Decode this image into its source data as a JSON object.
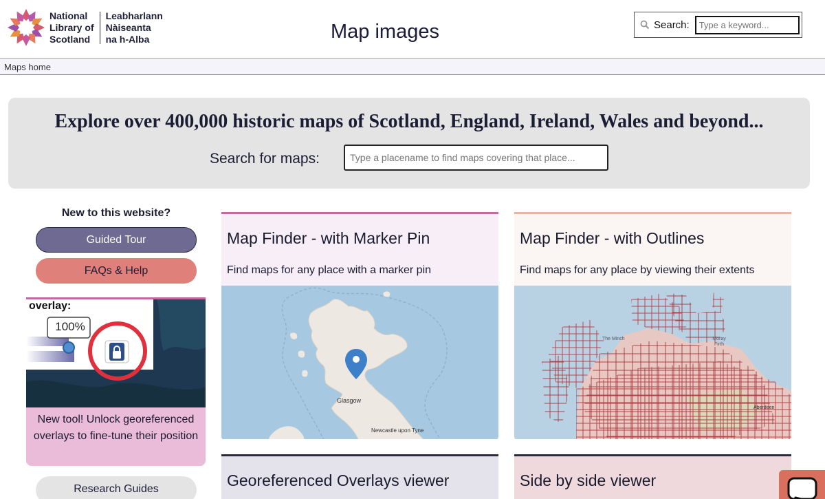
{
  "header": {
    "logo_line1": "National",
    "logo_line2": "Library of",
    "logo_line3": "Scotland",
    "logo_gaelic1": "Leabharlann",
    "logo_gaelic2": "Nàiseanta",
    "logo_gaelic3": "na h-Alba",
    "title": "Map images",
    "search_label": "Search:",
    "search_placeholder": "Type a keyword..."
  },
  "breadcrumb": {
    "home": "Maps home"
  },
  "hero": {
    "heading": "Explore over 400,000 historic maps of Scotland, England, Ireland, Wales and beyond...",
    "search_label": "Search for maps:",
    "search_placeholder": "Type a placename to find maps covering that place..."
  },
  "sidebar": {
    "new_question": "New to this website?",
    "tour_button": "Guided Tour",
    "faq_button": "FAQs & Help",
    "promo_overlay_label": "overlay:",
    "promo_percent": "100%",
    "promo_text": "New tool! Unlock georeferenced overlays to fine-tune their position",
    "research_button": "Research Guides"
  },
  "cards": [
    {
      "title": "Map Finder - with Marker Pin",
      "desc": "Find maps for any place with a marker pin",
      "map_labels": [
        "Glasgow",
        "Newcastle upon Tyne"
      ]
    },
    {
      "title": "Map Finder - with Outlines",
      "desc": "Find maps for any place by viewing their extents",
      "map_labels": [
        "The Minch",
        "Moray Firth",
        "Aberdeen"
      ]
    },
    {
      "title": "Georeferenced Overlays viewer",
      "desc": ""
    },
    {
      "title": "Side by side viewer",
      "desc": ""
    }
  ],
  "colors": {
    "tour": "#6e6a92",
    "faq": "#e0807a",
    "promo": "#ebbcd9",
    "sea": "#a6c8e0",
    "land": "#ede9e2",
    "pin": "#3d80c9",
    "outline": "#b9454c",
    "chat": "#d9705e"
  },
  "icons": [
    "logo-star-icon",
    "search-icon",
    "lock-icon",
    "map-pin-icon",
    "chat-icon"
  ]
}
